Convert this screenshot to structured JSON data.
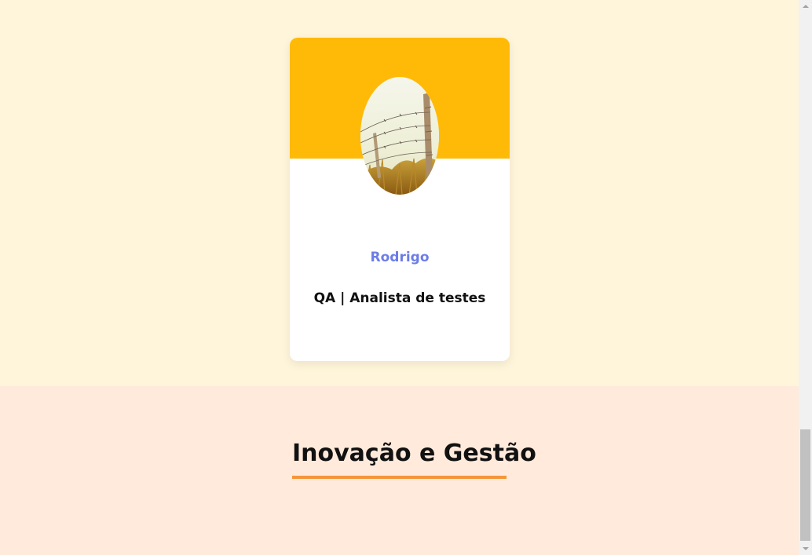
{
  "team": {
    "member": {
      "name": "Rodrigo",
      "role": "QA | Analista de testes",
      "avatar_icon": "fence-landscape-photo"
    }
  },
  "innovation": {
    "title": "Inovação e Gestão"
  },
  "colors": {
    "page_background": "#fff5da",
    "card_header": "#ffba08",
    "name_text": "#6c7de6",
    "section_background": "#ffeadb",
    "underline": "#f59539"
  },
  "scrollbar": {
    "position_fraction": 1.0
  }
}
